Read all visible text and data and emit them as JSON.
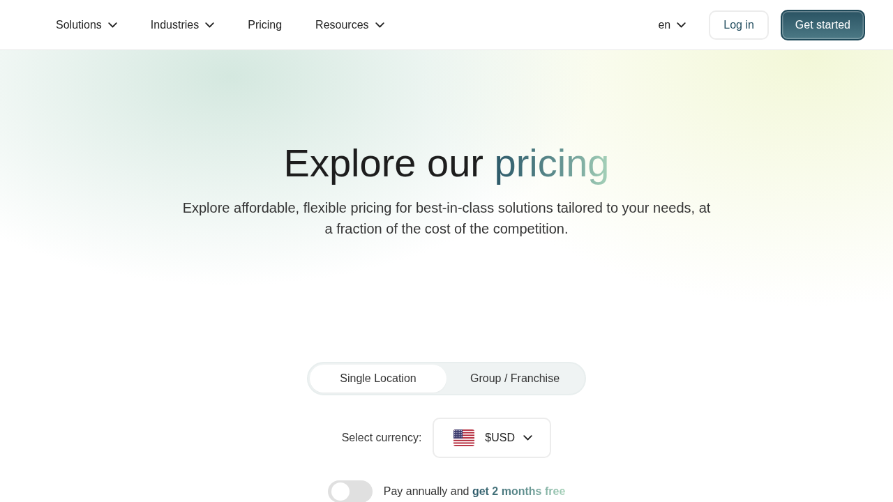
{
  "nav": {
    "items": [
      {
        "label": "Solutions",
        "kind": "dropdown"
      },
      {
        "label": "Industries",
        "kind": "dropdown"
      },
      {
        "label": "Pricing",
        "kind": "link"
      },
      {
        "label": "Resources",
        "kind": "dropdown"
      }
    ],
    "language": "en",
    "login": "Log in",
    "cta": "Get started"
  },
  "hero": {
    "title": "Explore our",
    "title_highlight": "pricing",
    "subtitle": "Explore affordable, flexible pricing for best-in-class solutions tailored to your needs, at a fraction of the cost of the competition."
  },
  "plan_tabs": [
    {
      "label": "Single Location",
      "selected": true
    },
    {
      "label": "Group / Franchise",
      "selected": false
    }
  ],
  "currency": {
    "label": "Select currency:",
    "value": "$USD"
  },
  "billing": {
    "annual": false,
    "text": "Pay annually and **get 2 months free**"
  }
}
